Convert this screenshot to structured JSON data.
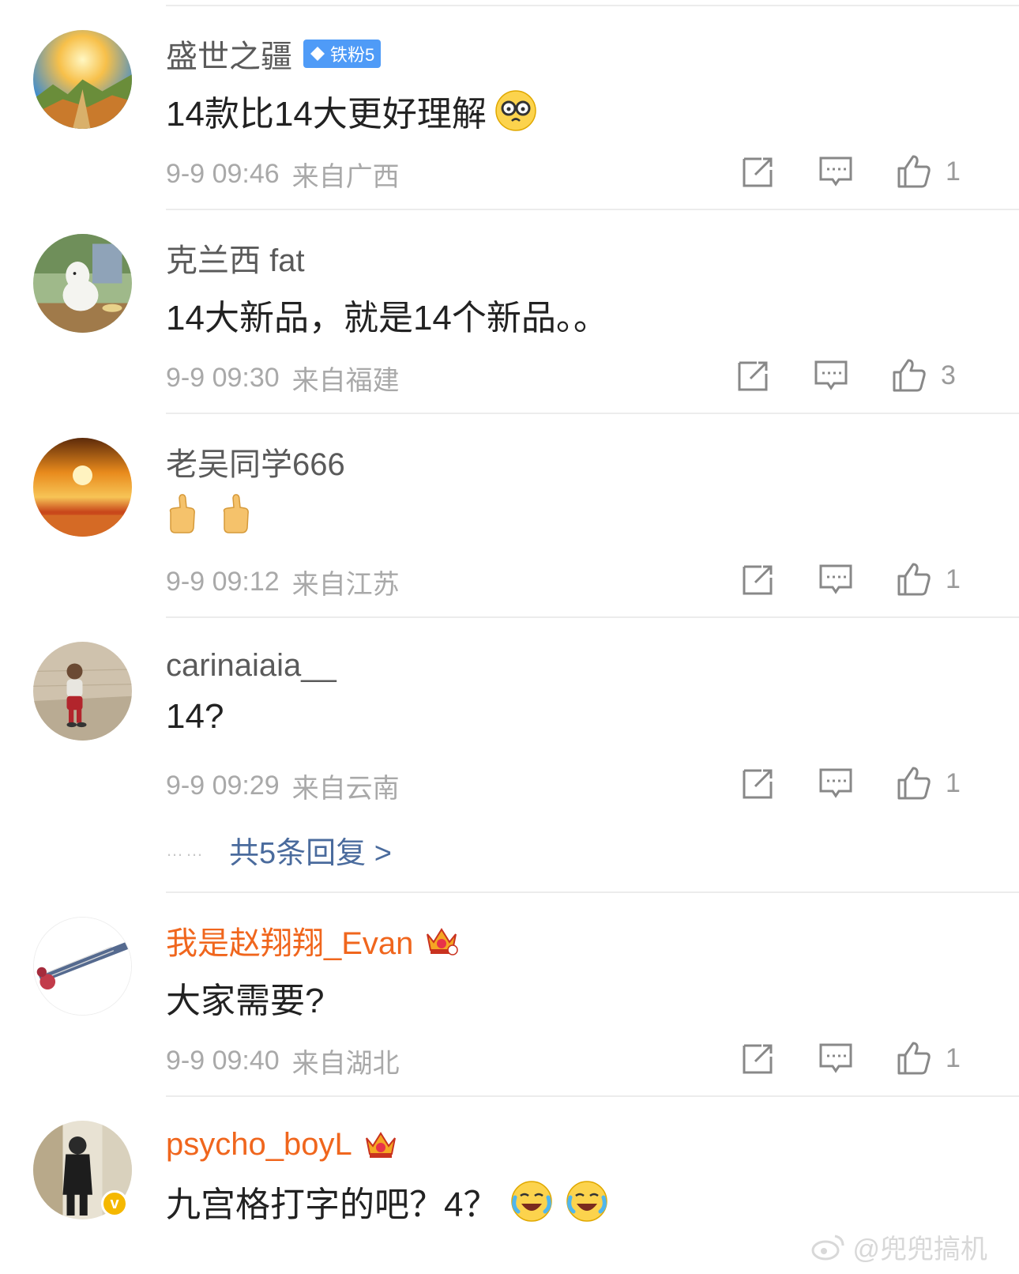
{
  "comments": [
    {
      "username": "盛世之疆",
      "badge": "铁粉5",
      "text": "14款比14大更好理解",
      "time": "9-9 09:46",
      "location": "来自广西",
      "likes": "1"
    },
    {
      "username": "克兰西 fat",
      "text": "14大新品，就是14个新品。。",
      "time": "9-9 09:30",
      "location": "来自福建",
      "likes": "3"
    },
    {
      "username": "老吴同学666",
      "text": "",
      "time": "9-9 09:12",
      "location": "来自江苏",
      "likes": "1"
    },
    {
      "username": "carinaiaia__",
      "text": "14?",
      "time": "9-9 09:29",
      "location": "来自云南",
      "likes": "1",
      "replies_label": "共5条回复 >"
    },
    {
      "username": "我是赵翔翔_Evan",
      "text": "大家需要?",
      "time": "9-9 09:40",
      "location": "来自湖北",
      "likes": "1"
    },
    {
      "username": "psycho_boyL",
      "text": "九宫格打字的吧？4？",
      "verified_mark": "v"
    }
  ],
  "replies_dots": "……",
  "watermark": "@兜兜搞机",
  "icons": {
    "repost": "repost-icon",
    "comment": "comment-icon",
    "like": "thumbs-up-icon",
    "emoji_1": "nerd-glasses-emoji",
    "emoji_3": "thumbs-up-emoji",
    "emoji_6": "laughing-crying-emoji"
  },
  "colors": {
    "vip_name": "#f0661d",
    "link": "#4a6b9d",
    "badge_bg": "#4f9bf7",
    "meta_text": "#a9a9a9"
  }
}
